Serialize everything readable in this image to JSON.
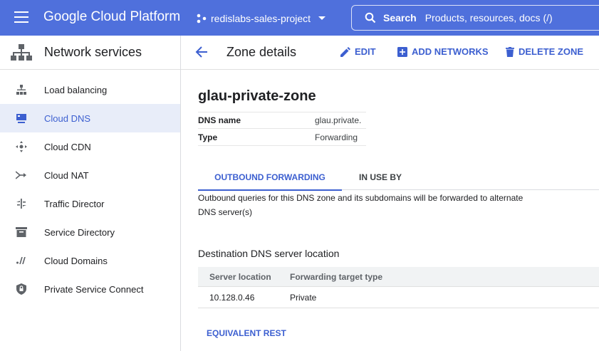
{
  "topbar": {
    "brand": "Google Cloud Platform",
    "project_name": "redislabs-sales-project",
    "search_label": "Search",
    "search_hint": "Products, resources, docs (/)",
    "bar_color": "#4f70dc"
  },
  "sidebar": {
    "title": "Network services",
    "items": [
      {
        "label": "Load balancing",
        "icon": "load-balancing-icon"
      },
      {
        "label": "Cloud DNS",
        "icon": "dns-icon",
        "active": true
      },
      {
        "label": "Cloud CDN",
        "icon": "cdn-icon"
      },
      {
        "label": "Cloud NAT",
        "icon": "nat-icon"
      },
      {
        "label": "Traffic Director",
        "icon": "traffic-director-icon"
      },
      {
        "label": "Service Directory",
        "icon": "service-directory-icon"
      },
      {
        "label": "Cloud Domains",
        "icon": "domains-icon"
      },
      {
        "label": "Private Service Connect",
        "icon": "private-service-connect-icon"
      }
    ]
  },
  "header": {
    "title": "Zone details",
    "edit_label": "EDIT",
    "add_networks_label": "ADD NETWORKS",
    "delete_label": "DELETE ZONE"
  },
  "zone": {
    "name": "glau-private-zone",
    "fields": [
      {
        "key": "DNS name",
        "value": "glau.private."
      },
      {
        "key": "Type",
        "value": "Forwarding"
      }
    ]
  },
  "tabs": [
    {
      "label": "OUTBOUND FORWARDING",
      "active": true
    },
    {
      "label": "IN USE BY",
      "active": false
    }
  ],
  "description": {
    "line1": "Outbound queries for this DNS zone and its subdomains will be forwarded to alternate",
    "line2": "DNS server(s)"
  },
  "destination": {
    "title": "Destination DNS server location",
    "columns": [
      "Server location",
      "Forwarding target type"
    ],
    "rows": [
      [
        "10.128.0.46",
        "Private"
      ]
    ]
  },
  "equivalent_rest_label": "EQUIVALENT REST",
  "colors": {
    "accent": "#3c5fd0",
    "active_bg": "#e8edf9"
  }
}
